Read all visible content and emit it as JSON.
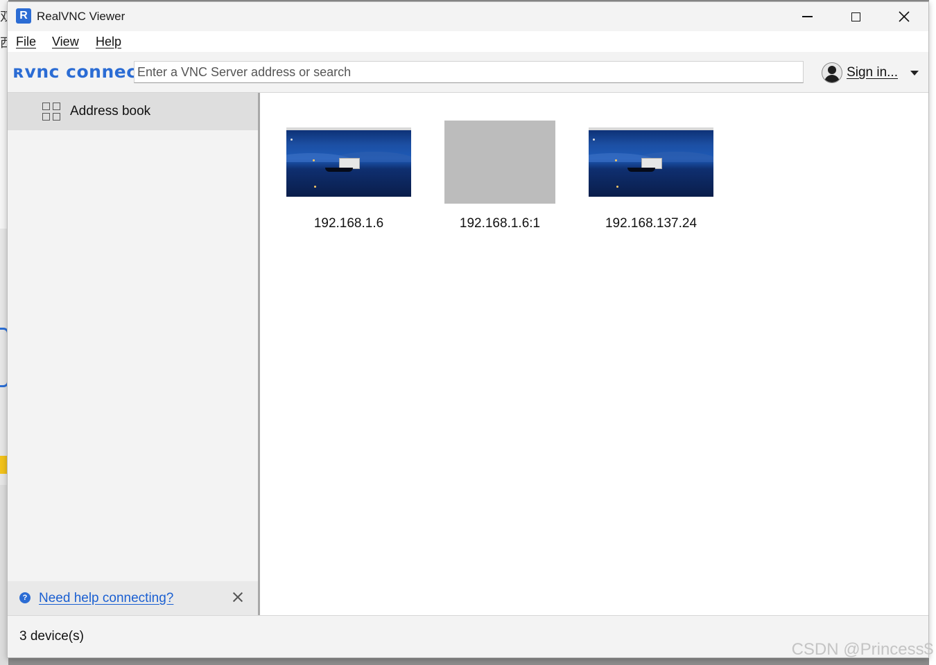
{
  "window": {
    "title": "RealVNC Viewer"
  },
  "menu": {
    "file": "File",
    "view": "View",
    "help": "Help"
  },
  "toolbar": {
    "logo": "ʀvnc connect",
    "search_placeholder": "Enter a VNC Server address or search",
    "search_value": "",
    "signin_label": "Sign in..."
  },
  "sidebar": {
    "items": [
      {
        "label": "Address book",
        "icon": "grid-icon",
        "selected": true
      }
    ],
    "help_link": "Need help connecting?"
  },
  "devices": [
    {
      "label": "192.168.1.6",
      "thumbnail": "desktop-preview"
    },
    {
      "label": "192.168.1.6:1",
      "thumbnail": "blank-preview"
    },
    {
      "label": "192.168.137.24",
      "thumbnail": "desktop-preview"
    }
  ],
  "status": {
    "device_count": "3 device(s)"
  },
  "watermark": "CSDN @Princess$",
  "colors": {
    "accent": "#2b6cd4",
    "link": "#1a5fd1",
    "sidebar_selected": "#dedede"
  }
}
